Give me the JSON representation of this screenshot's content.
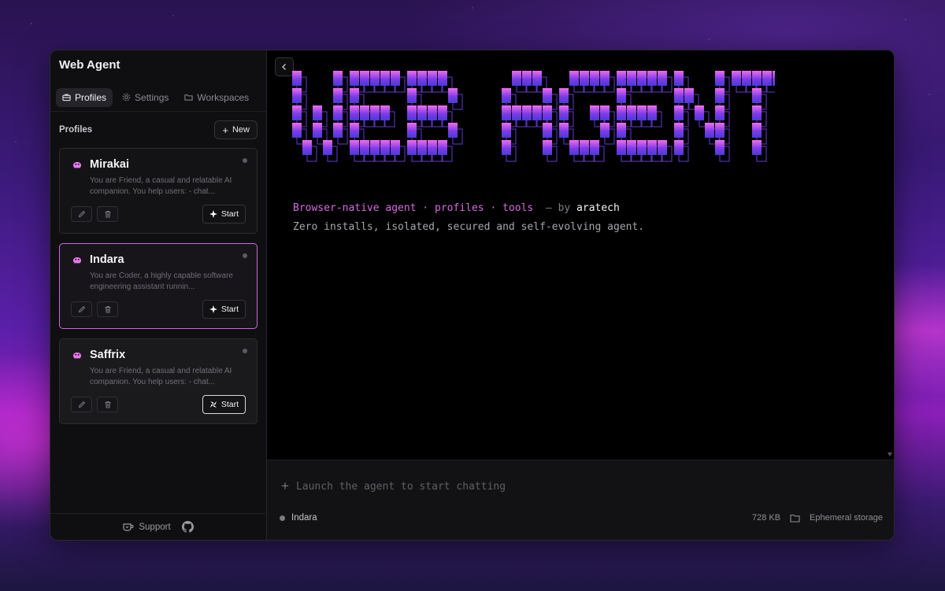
{
  "app": {
    "title": "Web Agent"
  },
  "tabs": [
    {
      "label": "Profiles",
      "icon": "briefcase-icon",
      "active": true
    },
    {
      "label": "Settings",
      "icon": "gear-icon",
      "active": false
    },
    {
      "label": "Workspaces",
      "icon": "folder-icon",
      "active": false
    }
  ],
  "profiles_section": {
    "title": "Profiles",
    "new_label": "New"
  },
  "profiles": [
    {
      "name": "Mirakai",
      "description": "You are Friend, a casual and relatable AI companion. You help users: - chat...",
      "start_label": "Start",
      "start_icon": "sparkle-icon"
    },
    {
      "name": "Indara",
      "description": "You are Coder, a highly capable software engineering assistant runnin...",
      "start_label": "Start",
      "start_icon": "sparkle-icon"
    },
    {
      "name": "Saffrix",
      "description": "You are Friend, a casual and relatable AI companion. You help users: - chat...",
      "start_label": "Start",
      "start_icon": "pinwheel-icon"
    }
  ],
  "footer": {
    "support_label": "Support"
  },
  "banner": {
    "text": "WEB AGENT",
    "colors": [
      "#f06cf0",
      "#7d3ce8",
      "#4a3ad8"
    ]
  },
  "main": {
    "tagline": "Browser-native agent · profiles · tools",
    "tagline_sep": "—",
    "tagline_by": "by",
    "tagline_author": "aratech",
    "subtitle": "Zero installs, isolated, secured and self-evolving agent."
  },
  "composer": {
    "placeholder": "Launch the agent to start chatting",
    "active_profile": "Indara",
    "size": "728 KB",
    "storage": "Ephemeral storage"
  },
  "colors": {
    "accent": "#d76ae0",
    "selected_border": "#c96bdc"
  }
}
